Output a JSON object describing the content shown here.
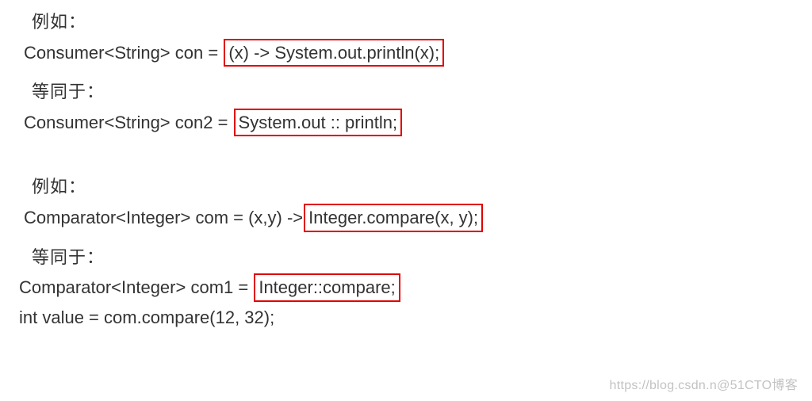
{
  "section1": {
    "heading": "例如：",
    "line1_pre": "Consumer<String> con = ",
    "line1_box": "(x) -> System.out.println(x);",
    "subheading": "等同于：",
    "line2_pre": "Consumer<String> con2 = ",
    "line2_box": "System.out :: println;"
  },
  "section2": {
    "heading": "例如：",
    "line1_pre": "Comparator<Integer> com = (x,y) ->",
    "line1_box": "Integer.compare(x, y);",
    "subheading": "等同于：",
    "line2_pre": "Comparator<Integer> com1 = ",
    "line2_box": "Integer::compare;",
    "line3": "int value = com.compare(12, 32);"
  },
  "watermark": "https://blog.csdn.n@51CTO博客"
}
